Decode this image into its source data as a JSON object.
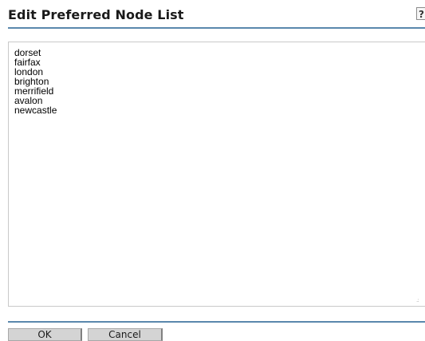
{
  "header": {
    "title": "Edit Preferred Node List",
    "help_label": "?"
  },
  "node_list": {
    "items": [
      "dorset",
      "fairfax",
      "london",
      "brighton",
      "merrifield",
      "avalon",
      "newcastle"
    ]
  },
  "footer": {
    "ok_label": "OK",
    "cancel_label": "Cancel"
  },
  "colors": {
    "rule": "#5a88ad",
    "button_bg": "#d4d4d4"
  }
}
